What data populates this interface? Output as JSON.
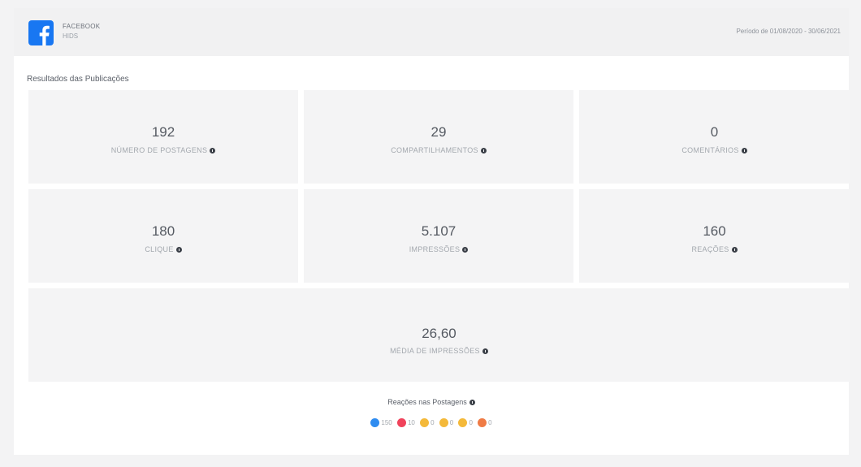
{
  "header": {
    "brand": "FACEBOOK",
    "account": "HIDS",
    "period": "Período de 01/08/2020 - 30/06/2021",
    "brand_color": "#1877f2"
  },
  "section_title": "Resultados das Publicações",
  "metrics": [
    {
      "value": "192",
      "label": "NÚMERO DE POSTAGENS"
    },
    {
      "value": "29",
      "label": "COMPARTILHAMENTOS"
    },
    {
      "value": "0",
      "label": "COMENTÁRIOS"
    },
    {
      "value": "180",
      "label": "CLIQUE"
    },
    {
      "value": "5.107",
      "label": "IMPRESSÕES"
    },
    {
      "value": "160",
      "label": "REAÇÕES"
    },
    {
      "value": "26,60",
      "label": "MÉDIA DE IMPRESSÕES"
    }
  ],
  "reactions": {
    "title": "Reações nas Postagens",
    "items": [
      {
        "icon": "like-icon",
        "count": "150",
        "color": "#2f8cf0"
      },
      {
        "icon": "love-icon",
        "count": "10",
        "color": "#f0435b"
      },
      {
        "icon": "haha-icon",
        "count": "0",
        "color": "#f4b93a"
      },
      {
        "icon": "wow-icon",
        "count": "0",
        "color": "#f4b93a"
      },
      {
        "icon": "sad-icon",
        "count": "0",
        "color": "#f4b93a"
      },
      {
        "icon": "angry-icon",
        "count": "0",
        "color": "#ef7b45"
      }
    ]
  }
}
